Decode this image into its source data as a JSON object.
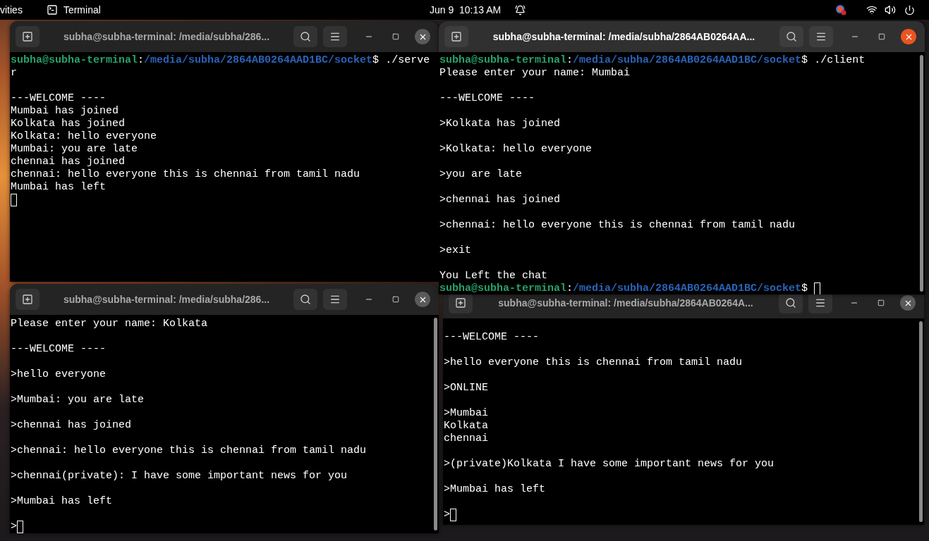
{
  "top_bar": {
    "activities": "vities",
    "app": "Terminal",
    "clock": "Jun 9  10:13 AM"
  },
  "windows": [
    {
      "title": "subha@subha-terminal: /media/subha/286...",
      "active": false,
      "scrollbar": false,
      "lines": [
        {
          "kind": "prompt",
          "user": "subha@subha-terminal",
          "colon": ":",
          "path": "/media/subha/2864AB0264AAD1BC/socket",
          "symbol": "$",
          "command": "./serve",
          "cursor": false
        },
        {
          "kind": "text",
          "text": "r",
          "cursor": false
        },
        {
          "kind": "blank"
        },
        {
          "kind": "text",
          "text": "---WELCOME ----",
          "cursor": false
        },
        {
          "kind": "text",
          "text": "Mumbai has joined",
          "cursor": false
        },
        {
          "kind": "text",
          "text": "Kolkata has joined",
          "cursor": false
        },
        {
          "kind": "text",
          "text": "Kolkata: hello everyone",
          "cursor": false
        },
        {
          "kind": "text",
          "text": "Mumbai: you are late",
          "cursor": false
        },
        {
          "kind": "text",
          "text": "chennai has joined",
          "cursor": false
        },
        {
          "kind": "text",
          "text": "chennai: hello everyone this is chennai from tamil nadu",
          "cursor": false
        },
        {
          "kind": "text",
          "text": "Mumbai has left",
          "cursor": false
        },
        {
          "kind": "empty",
          "cursor": true
        }
      ]
    },
    {
      "title": "subha@subha-terminal: /media/subha/2864AB0264AA...",
      "active": true,
      "scrollbar": true,
      "lines": [
        {
          "kind": "prompt",
          "user": "subha@subha-terminal",
          "colon": ":",
          "path": "/media/subha/2864AB0264AAD1BC/socket",
          "symbol": "$",
          "command": "./client",
          "cursor": false
        },
        {
          "kind": "text",
          "text": "Please enter your name: Mumbai",
          "cursor": false
        },
        {
          "kind": "blank"
        },
        {
          "kind": "text",
          "text": "---WELCOME ----",
          "cursor": false
        },
        {
          "kind": "blank"
        },
        {
          "kind": "text",
          "text": ">Kolkata has joined",
          "cursor": false
        },
        {
          "kind": "blank"
        },
        {
          "kind": "text",
          "text": ">Kolkata: hello everyone",
          "cursor": false
        },
        {
          "kind": "blank"
        },
        {
          "kind": "text",
          "text": ">you are late",
          "cursor": false
        },
        {
          "kind": "blank"
        },
        {
          "kind": "text",
          "text": ">chennai has joined",
          "cursor": false
        },
        {
          "kind": "blank"
        },
        {
          "kind": "text",
          "text": ">chennai: hello everyone this is chennai from tamil nadu",
          "cursor": false
        },
        {
          "kind": "blank"
        },
        {
          "kind": "text",
          "text": ">exit",
          "cursor": false
        },
        {
          "kind": "blank"
        },
        {
          "kind": "text",
          "text": "You Left the chat",
          "cursor": false
        },
        {
          "kind": "prompt",
          "user": "subha@subha-terminal",
          "colon": ":",
          "path": "/media/subha/2864AB0264AAD1BC/socket",
          "symbol": "$",
          "cursor": true
        }
      ]
    },
    {
      "title": "subha@subha-terminal: /media/subha/286...",
      "active": false,
      "scrollbar": true,
      "lines": [
        {
          "kind": "text",
          "text": "Please enter your name: Kolkata",
          "cursor": false
        },
        {
          "kind": "blank"
        },
        {
          "kind": "text",
          "text": "---WELCOME ----",
          "cursor": false
        },
        {
          "kind": "blank"
        },
        {
          "kind": "text",
          "text": ">hello everyone",
          "cursor": false
        },
        {
          "kind": "blank"
        },
        {
          "kind": "text",
          "text": ">Mumbai: you are late",
          "cursor": false
        },
        {
          "kind": "blank"
        },
        {
          "kind": "text",
          "text": ">chennai has joined",
          "cursor": false
        },
        {
          "kind": "blank"
        },
        {
          "kind": "text",
          "text": ">chennai: hello everyone this is chennai from tamil nadu",
          "cursor": false
        },
        {
          "kind": "blank"
        },
        {
          "kind": "text",
          "text": ">chennai(private): I have some important news for you",
          "cursor": false
        },
        {
          "kind": "blank"
        },
        {
          "kind": "text",
          "text": ">Mumbai has left",
          "cursor": false
        },
        {
          "kind": "blank"
        },
        {
          "kind": "text",
          "text": ">",
          "cursor": true
        }
      ]
    },
    {
      "title": "subha@subha-terminal: /media/subha/2864AB0264A...",
      "active": false,
      "scrollbar": true,
      "lines": [
        {
          "kind": "blank"
        },
        {
          "kind": "text",
          "text": "---WELCOME ----",
          "cursor": false
        },
        {
          "kind": "blank"
        },
        {
          "kind": "text",
          "text": ">hello everyone this is chennai from tamil nadu",
          "cursor": false
        },
        {
          "kind": "blank"
        },
        {
          "kind": "text",
          "text": ">ONLINE",
          "cursor": false
        },
        {
          "kind": "blank"
        },
        {
          "kind": "text",
          "text": ">Mumbai",
          "cursor": false
        },
        {
          "kind": "text",
          "text": "Kolkata",
          "cursor": false
        },
        {
          "kind": "text",
          "text": "chennai",
          "cursor": false
        },
        {
          "kind": "blank"
        },
        {
          "kind": "text",
          "text": ">(private)Kolkata I have some important news for you",
          "cursor": false
        },
        {
          "kind": "blank"
        },
        {
          "kind": "text",
          "text": ">Mumbai has left",
          "cursor": false
        },
        {
          "kind": "blank"
        },
        {
          "kind": "text",
          "text": ">",
          "cursor": true
        }
      ]
    }
  ]
}
